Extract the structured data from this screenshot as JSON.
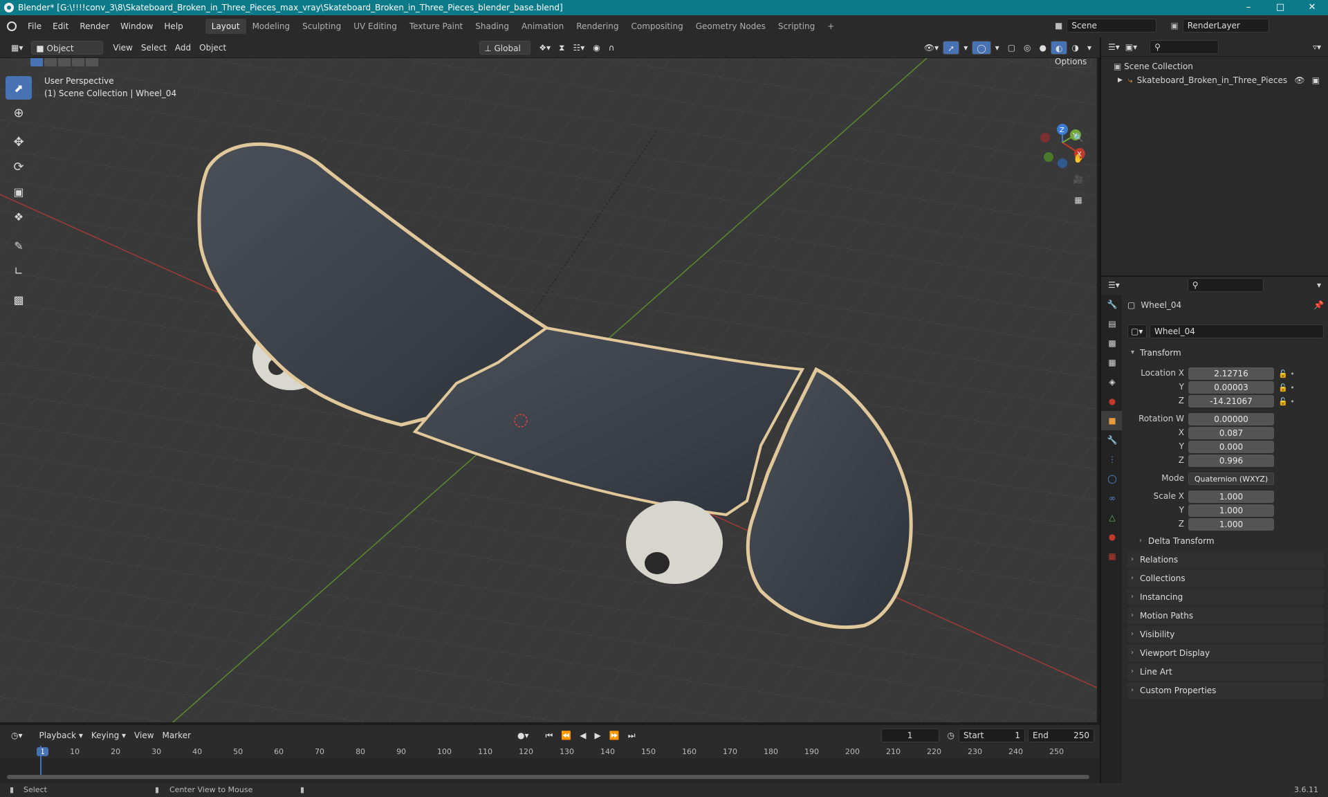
{
  "titlebar": {
    "title": "Blender* [G:\\!!!!conv_3\\8\\Skateboard_Broken_in_Three_Pieces_max_vray\\Skateboard_Broken_in_Three_Pieces_blender_base.blend]"
  },
  "menu": {
    "items": [
      "File",
      "Edit",
      "Render",
      "Window",
      "Help"
    ]
  },
  "workspaces": [
    "Layout",
    "Modeling",
    "Sculpting",
    "UV Editing",
    "Texture Paint",
    "Shading",
    "Animation",
    "Rendering",
    "Compositing",
    "Geometry Nodes",
    "Scripting"
  ],
  "active_workspace": "Layout",
  "scene": {
    "name": "Scene",
    "renderlayer": "RenderLayer"
  },
  "viewport_header": {
    "mode": "Object Mode",
    "menus": [
      "View",
      "Select",
      "Add",
      "Object"
    ],
    "orientation": "Global",
    "options": "Options"
  },
  "viewport": {
    "perspective": "User Perspective",
    "collection": "(1) Scene Collection | Wheel_04"
  },
  "gizmo": {
    "x": "X",
    "y": "Y",
    "z": "Z"
  },
  "outliner": {
    "root": "Scene Collection",
    "item": "Skateboard_Broken_in_Three_Pieces"
  },
  "properties": {
    "object_name": "Wheel_04",
    "data_name": "Wheel_04",
    "transform_label": "Transform",
    "location": {
      "label": "Location X",
      "x": "2.12716",
      "y": "0.00003",
      "z": "-14.21067"
    },
    "rotation": {
      "label": "Rotation W",
      "w": "0.00000",
      "x": "0.087",
      "y": "0.000",
      "z": "0.996"
    },
    "mode": {
      "label": "Mode",
      "value": "Quaternion (WXYZ)"
    },
    "scale": {
      "label": "Scale X",
      "x": "1.000",
      "y": "1.000",
      "z": "1.000"
    },
    "axis_labels": {
      "y": "Y",
      "z": "Z",
      "x": "X"
    },
    "delta": "Delta Transform",
    "panels": [
      "Relations",
      "Collections",
      "Instancing",
      "Motion Paths",
      "Visibility",
      "Viewport Display",
      "Line Art",
      "Custom Properties"
    ]
  },
  "timeline": {
    "menus": [
      "Playback",
      "Keying",
      "View",
      "Marker"
    ],
    "current_frame": "1",
    "start_label": "Start",
    "start": "1",
    "end_label": "End",
    "end": "250",
    "ticks": [
      "1",
      "10",
      "20",
      "30",
      "40",
      "50",
      "60",
      "70",
      "80",
      "90",
      "100",
      "110",
      "120",
      "130",
      "140",
      "150",
      "160",
      "170",
      "180",
      "190",
      "200",
      "210",
      "220",
      "230",
      "240",
      "250"
    ]
  },
  "status": {
    "left": "Select",
    "middle": "Center View to Mouse",
    "version": "3.6.11"
  },
  "colors": {
    "accent": "#4772b3",
    "titlebar": "#0d7a8a",
    "x_axis": "#c0392b",
    "y_axis": "#6fa832",
    "z_axis": "#3a7bd5"
  }
}
